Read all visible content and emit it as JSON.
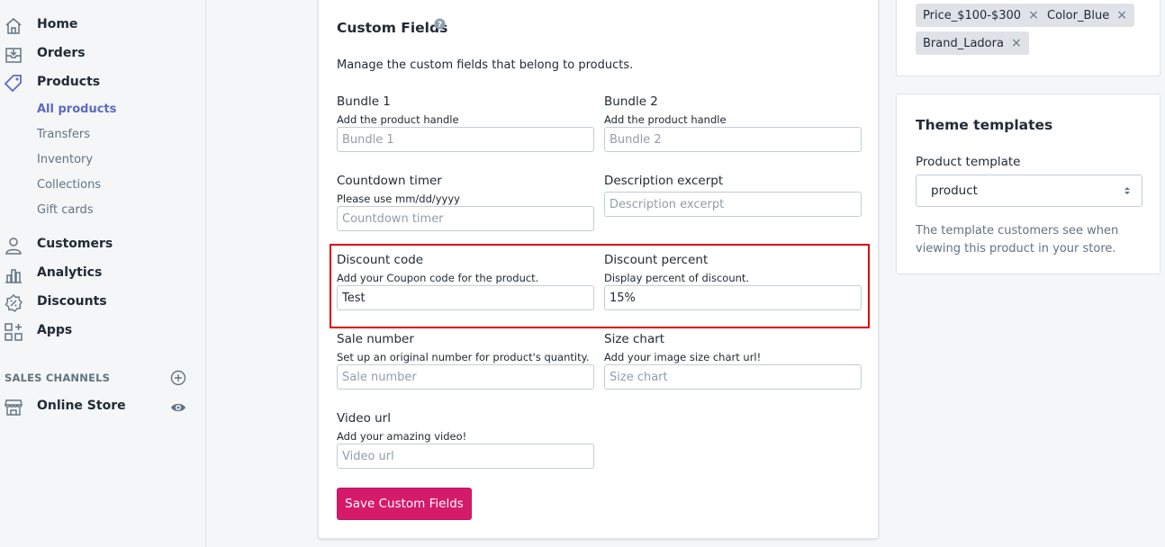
{
  "sidebar": {
    "nav": [
      {
        "label": "Home",
        "icon": "home-icon"
      },
      {
        "label": "Orders",
        "icon": "orders-icon"
      },
      {
        "label": "Products",
        "icon": "tag-icon"
      }
    ],
    "sub_items": [
      "All products",
      "Transfers",
      "Inventory",
      "Collections",
      "Gift cards"
    ],
    "nav2": [
      {
        "label": "Customers",
        "icon": "person-icon"
      },
      {
        "label": "Analytics",
        "icon": "analytics-icon"
      },
      {
        "label": "Discounts",
        "icon": "discount-icon"
      },
      {
        "label": "Apps",
        "icon": "apps-icon"
      }
    ],
    "sales_channels_label": "SALES CHANNELS",
    "online_store_label": "Online Store"
  },
  "custom_fields": {
    "title": "Custom Fields",
    "description": "Manage the custom fields that belong to products.",
    "fields": [
      {
        "label": "Bundle 1",
        "help": "Add the product handle",
        "placeholder": "Bundle 1",
        "value": ""
      },
      {
        "label": "Bundle 2",
        "help": "Add the product handle",
        "placeholder": "Bundle 2",
        "value": ""
      },
      {
        "label": "Countdown timer",
        "help": "Please use mm/dd/yyyy",
        "placeholder": "Countdown timer",
        "value": ""
      },
      {
        "label": "Description excerpt",
        "help": "",
        "placeholder": "Description excerpt",
        "value": ""
      },
      {
        "label": "Discount code",
        "help": "Add your Coupon code for the product.",
        "placeholder": "",
        "value": "Test"
      },
      {
        "label": "Discount percent",
        "help": "Display percent of discount.",
        "placeholder": "",
        "value": "15%"
      },
      {
        "label": "Sale number",
        "help": "Set up an original number for product's quantity.",
        "placeholder": "Sale number",
        "value": ""
      },
      {
        "label": "Size chart",
        "help": "Add your image size chart url!",
        "placeholder": "Size chart",
        "value": ""
      },
      {
        "label": "Video url",
        "help": "Add your amazing video!",
        "placeholder": "Video url",
        "value": ""
      }
    ],
    "save_label": "Save Custom Fields",
    "accent_color": "#d51a6a",
    "highlight_color": "#e00000"
  },
  "tags": [
    "Price_$100-$300",
    "Color_Blue",
    "Brand_Ladora"
  ],
  "theme": {
    "title": "Theme templates",
    "template_label": "Product template",
    "template_value": "product",
    "help": "The template customers see when viewing this product in your store."
  }
}
